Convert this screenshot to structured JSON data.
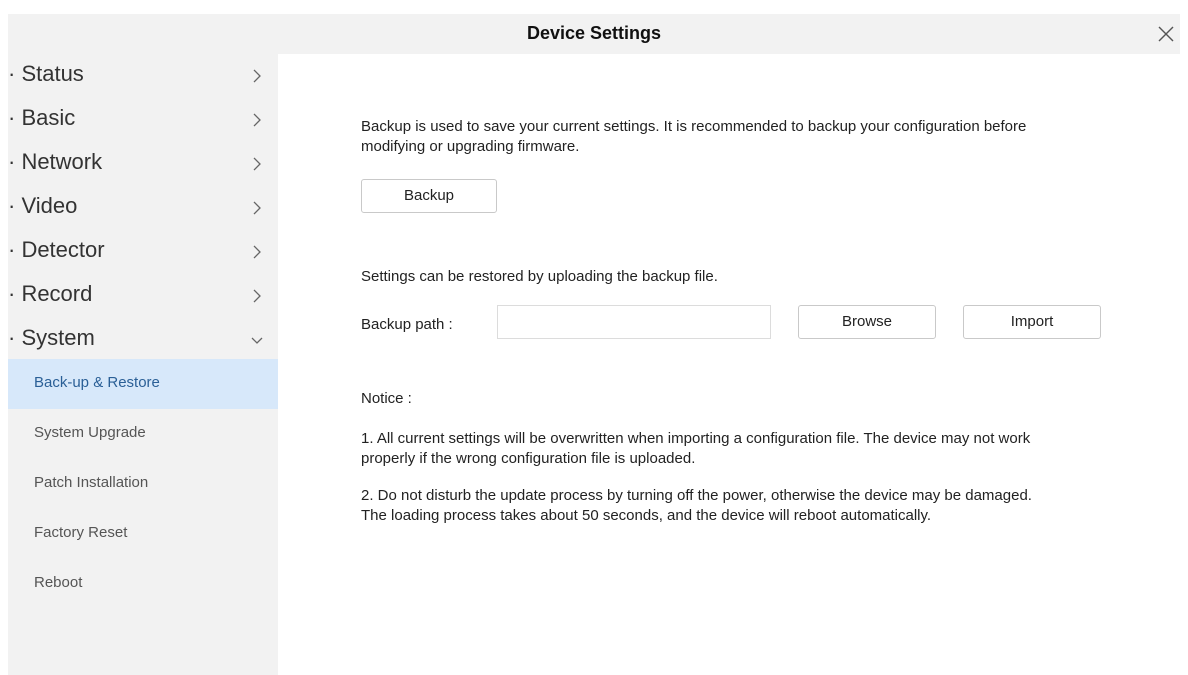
{
  "window": {
    "title": "Device Settings"
  },
  "sidebar": {
    "items": [
      {
        "label": "· Status"
      },
      {
        "label": "· Basic"
      },
      {
        "label": "· Network"
      },
      {
        "label": "· Video"
      },
      {
        "label": "· Detector"
      },
      {
        "label": "· Record"
      },
      {
        "label": "· System"
      }
    ],
    "system_subitems": [
      {
        "label": "Back-up & Restore",
        "active": true
      },
      {
        "label": "System Upgrade"
      },
      {
        "label": "Patch Installation"
      },
      {
        "label": "Factory Reset"
      },
      {
        "label": "Reboot"
      }
    ]
  },
  "main": {
    "backup_description": "Backup is used to save your current settings. It is recommended to backup your configuration before modifying or upgrading firmware.",
    "backup_description_line1": "Backup is used to save your current settings. It is recommended to backup your configuration before",
    "backup_description_line2": "modifying or upgrading firmware.",
    "backup_button": "Backup",
    "restore_description": "Settings can be restored by uploading the backup file.",
    "backup_path_label": "Backup path :",
    "backup_path_value": "",
    "browse_button": "Browse",
    "import_button": "Import",
    "notice_title": "Notice :",
    "notice_1_line1": "1. All current settings will be overwritten when importing a configuration file. The device may not work",
    "notice_1_line2": "properly if the wrong configuration file is uploaded.",
    "notice_2_line1": "2. Do not disturb the update process by turning off the power, otherwise the device may be damaged.",
    "notice_2_line2": "The loading process takes about 50 seconds, and the device will reboot automatically."
  },
  "colors": {
    "header_bg": "#f2f2f2",
    "sidebar_bg": "#f2f2f2",
    "active_bg": "#d7e8fa",
    "active_text": "#2a5f96"
  },
  "icons": {
    "close": "close-icon",
    "collapsed": "chevron-right-icon",
    "expanded": "chevron-down-icon"
  }
}
